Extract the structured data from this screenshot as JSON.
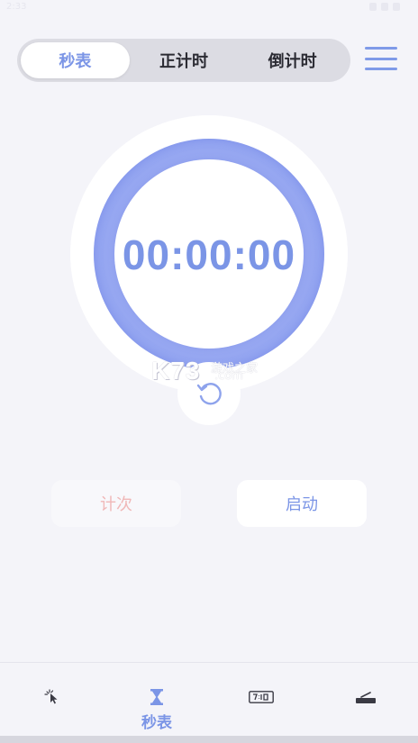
{
  "status_bar": {
    "time": "2:33"
  },
  "tabs": [
    {
      "label": "秒表",
      "active": true
    },
    {
      "label": "正计时",
      "active": false
    },
    {
      "label": "倒计时",
      "active": false
    }
  ],
  "timer": {
    "display": "00:00:00"
  },
  "watermark": {
    "logo": "K73",
    "cn": "游戏之家",
    "domain": ".com"
  },
  "buttons": {
    "lap": "计次",
    "start": "启动"
  },
  "bottom_nav": {
    "items": [
      {
        "icon": "cursor-tap-icon",
        "label": ""
      },
      {
        "icon": "hourglass-icon",
        "label": "秒表",
        "active": true
      },
      {
        "icon": "digital-clock-icon",
        "label": ""
      },
      {
        "icon": "desk-clock-icon",
        "label": ""
      }
    ]
  },
  "colors": {
    "accent": "#7b95e6",
    "ring": "#8a9df0",
    "background": "#f4f4f9",
    "lap_text": "#f0b8b8"
  }
}
